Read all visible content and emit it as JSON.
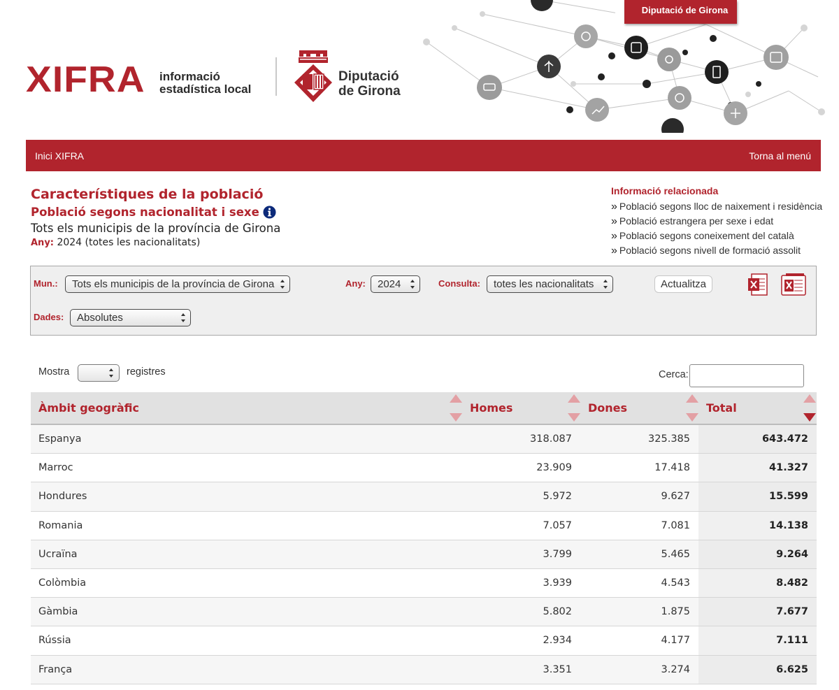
{
  "header": {
    "logo_main": "XIFRA",
    "logo_sub_line1": "informació",
    "logo_sub_line2": "estadística local",
    "org_line1": "Diputació",
    "org_line2": "de Girona",
    "org_tab": "Diputació de Girona"
  },
  "nav": {
    "home": "Inici XIFRA",
    "back": "Torna al menú"
  },
  "page": {
    "title": "Característiques de la població",
    "subtitle": "Població segons nacionalitat i sexe",
    "scope": "Tots els municipis de la província de Girona",
    "year_label": "Any:",
    "year_value": "2024 (totes les nacionalitats)"
  },
  "related": {
    "title": "Informació relacionada",
    "items": [
      "Població segons lloc de naixement i residència",
      "Població estrangera per sexe i edat",
      "Població segons coneixement del català",
      "Població segons nivell de formació assolit"
    ]
  },
  "filters": {
    "mun_label": "Mun.:",
    "mun_value": "Tots els municipis de la província de Girona",
    "any_label": "Any:",
    "any_value": "2024",
    "consulta_label": "Consulta:",
    "consulta_value": "totes les nacionalitats",
    "update_button": "Actualitza",
    "dades_label": "Dades:",
    "dades_value": "Absolutes"
  },
  "table_controls": {
    "show_label": "Mostra",
    "records_label": "registres",
    "search_label": "Cerca:",
    "search_value": ""
  },
  "table": {
    "columns": [
      "Àmbit geogràfic",
      "Homes",
      "Dones",
      "Total"
    ],
    "rows": [
      {
        "name": "Espanya",
        "homes": "318.087",
        "dones": "325.385",
        "total": "643.472"
      },
      {
        "name": "Marroc",
        "homes": "23.909",
        "dones": "17.418",
        "total": "41.327"
      },
      {
        "name": "Hondures",
        "homes": "5.972",
        "dones": "9.627",
        "total": "15.599"
      },
      {
        "name": "Romania",
        "homes": "7.057",
        "dones": "7.081",
        "total": "14.138"
      },
      {
        "name": "Ucraïna",
        "homes": "3.799",
        "dones": "5.465",
        "total": "9.264"
      },
      {
        "name": "Colòmbia",
        "homes": "3.939",
        "dones": "4.543",
        "total": "8.482"
      },
      {
        "name": "Gàmbia",
        "homes": "5.802",
        "dones": "1.875",
        "total": "7.677"
      },
      {
        "name": "Rússia",
        "homes": "2.934",
        "dones": "4.177",
        "total": "7.111"
      },
      {
        "name": "França",
        "homes": "3.351",
        "dones": "3.274",
        "total": "6.625"
      }
    ]
  },
  "colors": {
    "brand_red": "#b1242d",
    "header_gray": "#e1e1e1",
    "filter_bg": "#efefef"
  },
  "icons": [
    "info-icon",
    "excel-export-icon",
    "excel-export-all-icon",
    "sort-icon",
    "diputacio-crest-icon",
    "network-graphic"
  ]
}
